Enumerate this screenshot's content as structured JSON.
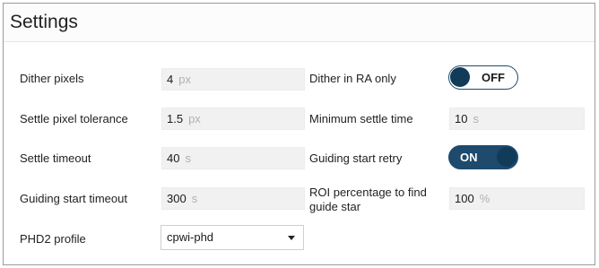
{
  "header": {
    "title": "Settings"
  },
  "left": {
    "dither_pixels": {
      "label": "Dither pixels",
      "value": "4",
      "unit": "px"
    },
    "settle_pixel_tolerance": {
      "label": "Settle pixel tolerance",
      "value": "1.5",
      "unit": "px"
    },
    "settle_timeout": {
      "label": "Settle timeout",
      "value": "40",
      "unit": "s"
    },
    "guiding_start_timeout": {
      "label": "Guiding start timeout",
      "value": "300",
      "unit": "s"
    },
    "phd2_profile": {
      "label": "PHD2 profile",
      "value": "cpwi-phd"
    }
  },
  "right": {
    "dither_ra_only": {
      "label": "Dither in RA only",
      "state": "OFF"
    },
    "minimum_settle_time": {
      "label": "Minimum settle time",
      "value": "10",
      "unit": "s"
    },
    "guiding_start_retry": {
      "label": "Guiding start retry",
      "state": "ON"
    },
    "roi_percentage": {
      "label_line1": "ROI percentage to find",
      "label_line2": "guide star",
      "value": "100",
      "unit": "%"
    }
  },
  "colors": {
    "accent": "#1d4a6d",
    "field_bg": "#f1f1f1",
    "unit_text": "#b0b0b0"
  },
  "icons": {
    "dropdown": "caret-down-icon"
  }
}
